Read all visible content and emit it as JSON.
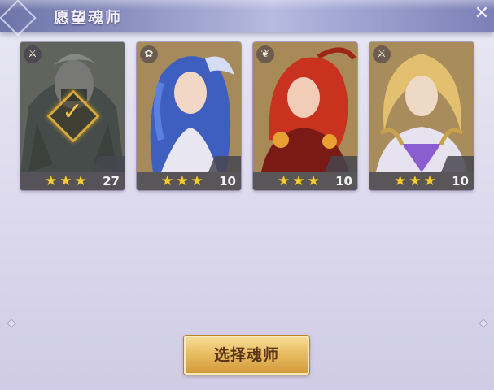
{
  "window": {
    "title": "愿望魂师"
  },
  "cards": [
    {
      "stars": "★★★",
      "level": "27",
      "class_icon": "⚔",
      "selected": true
    },
    {
      "stars": "★★★",
      "level": "10",
      "class_icon": "✿",
      "selected": false
    },
    {
      "stars": "★★★",
      "level": "10",
      "class_icon": "❦",
      "selected": false
    },
    {
      "stars": "★★★",
      "level": "10",
      "class_icon": "⚔",
      "selected": false
    }
  ],
  "footer": {
    "button_label": "选择魂师"
  },
  "colors": {
    "star": "#f2cc3a",
    "button_gold": "#e9bd62",
    "header_blue": "#8a90c0"
  }
}
